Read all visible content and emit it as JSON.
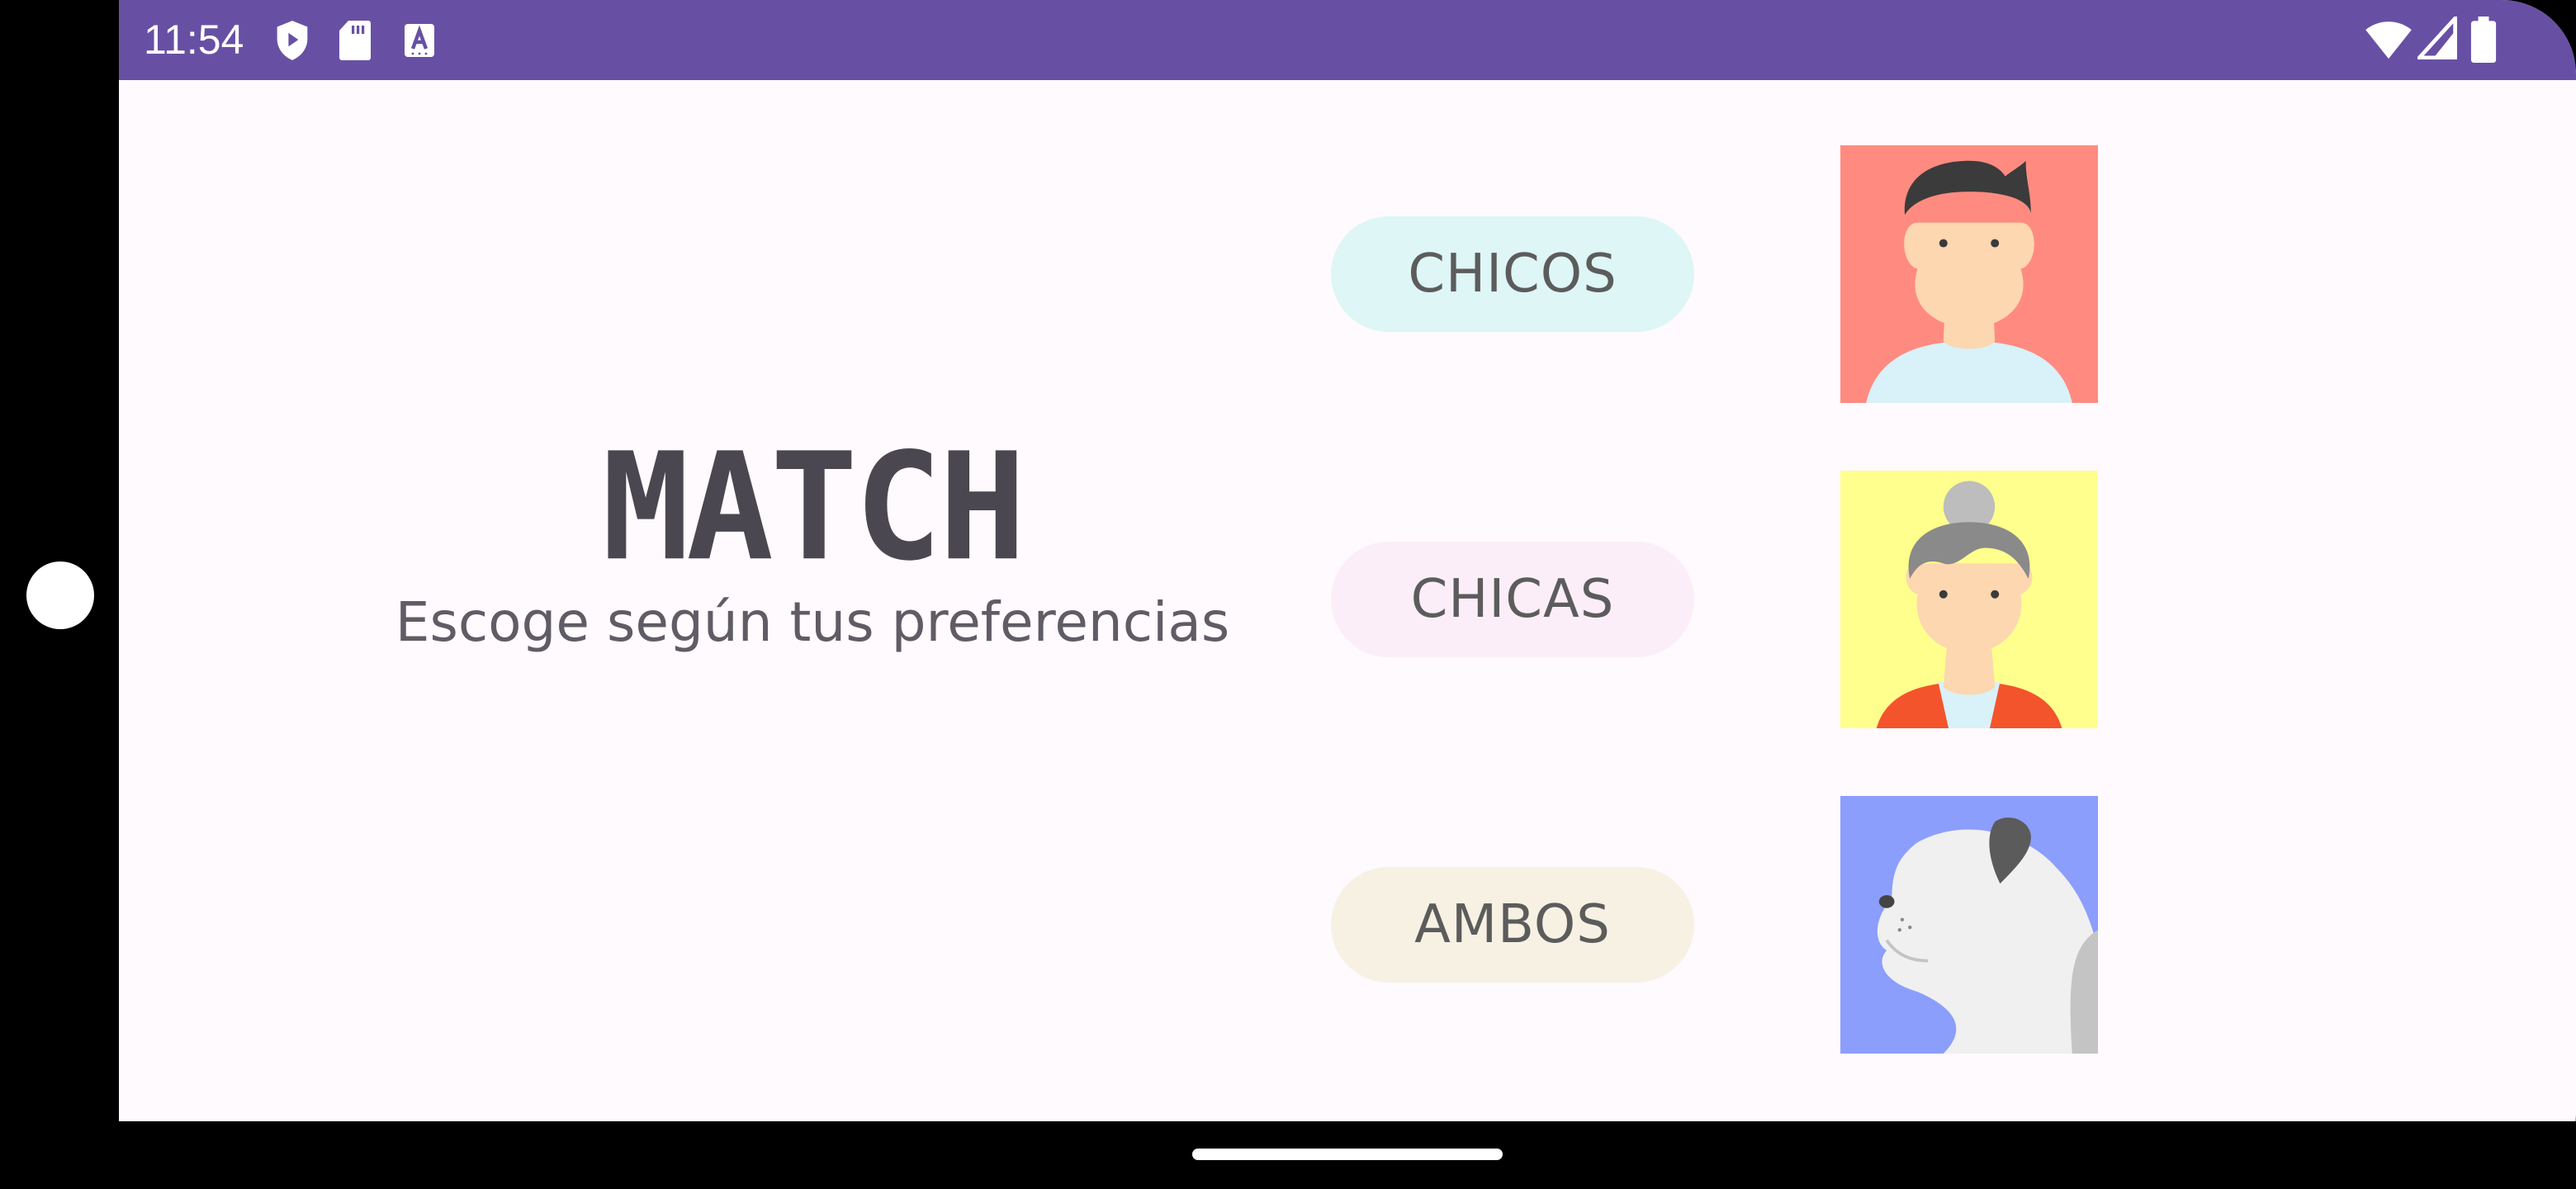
{
  "status_bar": {
    "time": "11:54",
    "left_icons": [
      "shield-play-icon",
      "sd-card-icon",
      "font-a-icon"
    ],
    "right_icons": [
      "wifi-icon",
      "cell-signal-icon",
      "battery-icon"
    ],
    "color": "#6750a4"
  },
  "main": {
    "title": "MATCH",
    "subtitle": "Escoge según tus preferencias"
  },
  "options": [
    {
      "label": "CHICOS",
      "color": "#def6f5",
      "image": "boy-avatar"
    },
    {
      "label": "CHICAS",
      "color": "#fbeef8",
      "image": "girl-avatar"
    },
    {
      "label": "AMBOS",
      "color": "#f7f1e3",
      "image": "dog-avatar"
    }
  ]
}
